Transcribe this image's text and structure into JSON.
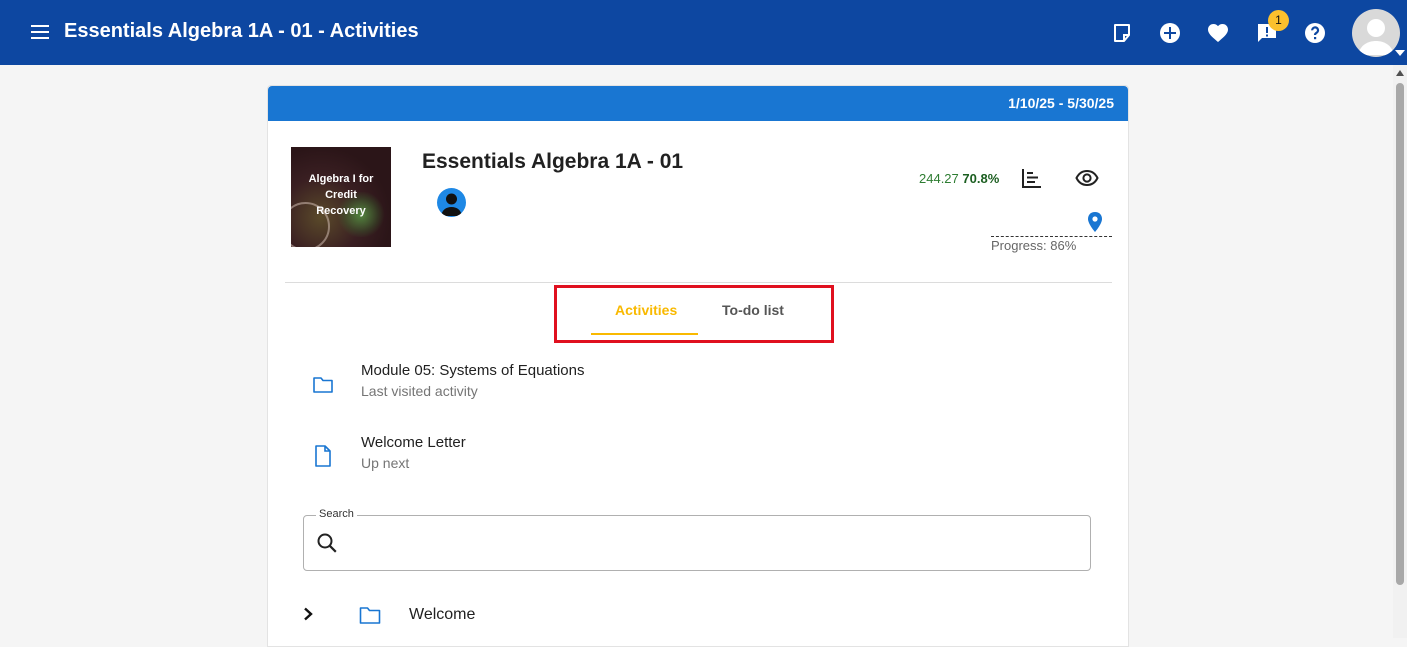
{
  "appbar": {
    "title": "Essentials Algebra 1A - 01 - Activities",
    "notification_count": "1",
    "icons": [
      "menu-icon",
      "note-icon",
      "add-circle-icon",
      "heart-icon",
      "feedback-icon",
      "help-icon",
      "account-avatar"
    ],
    "color": "#0d47a1"
  },
  "course": {
    "date_range": "1/10/25 - 5/30/25",
    "title": "Essentials Algebra 1A - 01",
    "thumbnail_text": "Algebra I for Credit Recovery",
    "score_points": "244.27",
    "score_percent": "70.8%",
    "progress_label": "Progress: 86%",
    "progress_value": 0.86
  },
  "tabs": [
    {
      "label": "Activities",
      "active": true
    },
    {
      "label": "To-do list",
      "active": false
    }
  ],
  "recent": [
    {
      "title": "Module 05: Systems of Equations",
      "subtitle": "Last visited activity",
      "icon": "folder-icon"
    },
    {
      "title": "Welcome Letter",
      "subtitle": "Up next",
      "icon": "document-icon"
    }
  ],
  "search": {
    "label": "Search",
    "value": ""
  },
  "tree": [
    {
      "label": "Welcome",
      "icon": "folder-icon",
      "expanded": false
    }
  ],
  "colors": {
    "accent": "#1976d2",
    "tab_active": "#f9b900",
    "highlight": "#e0101f",
    "score": "#2e7d32"
  }
}
